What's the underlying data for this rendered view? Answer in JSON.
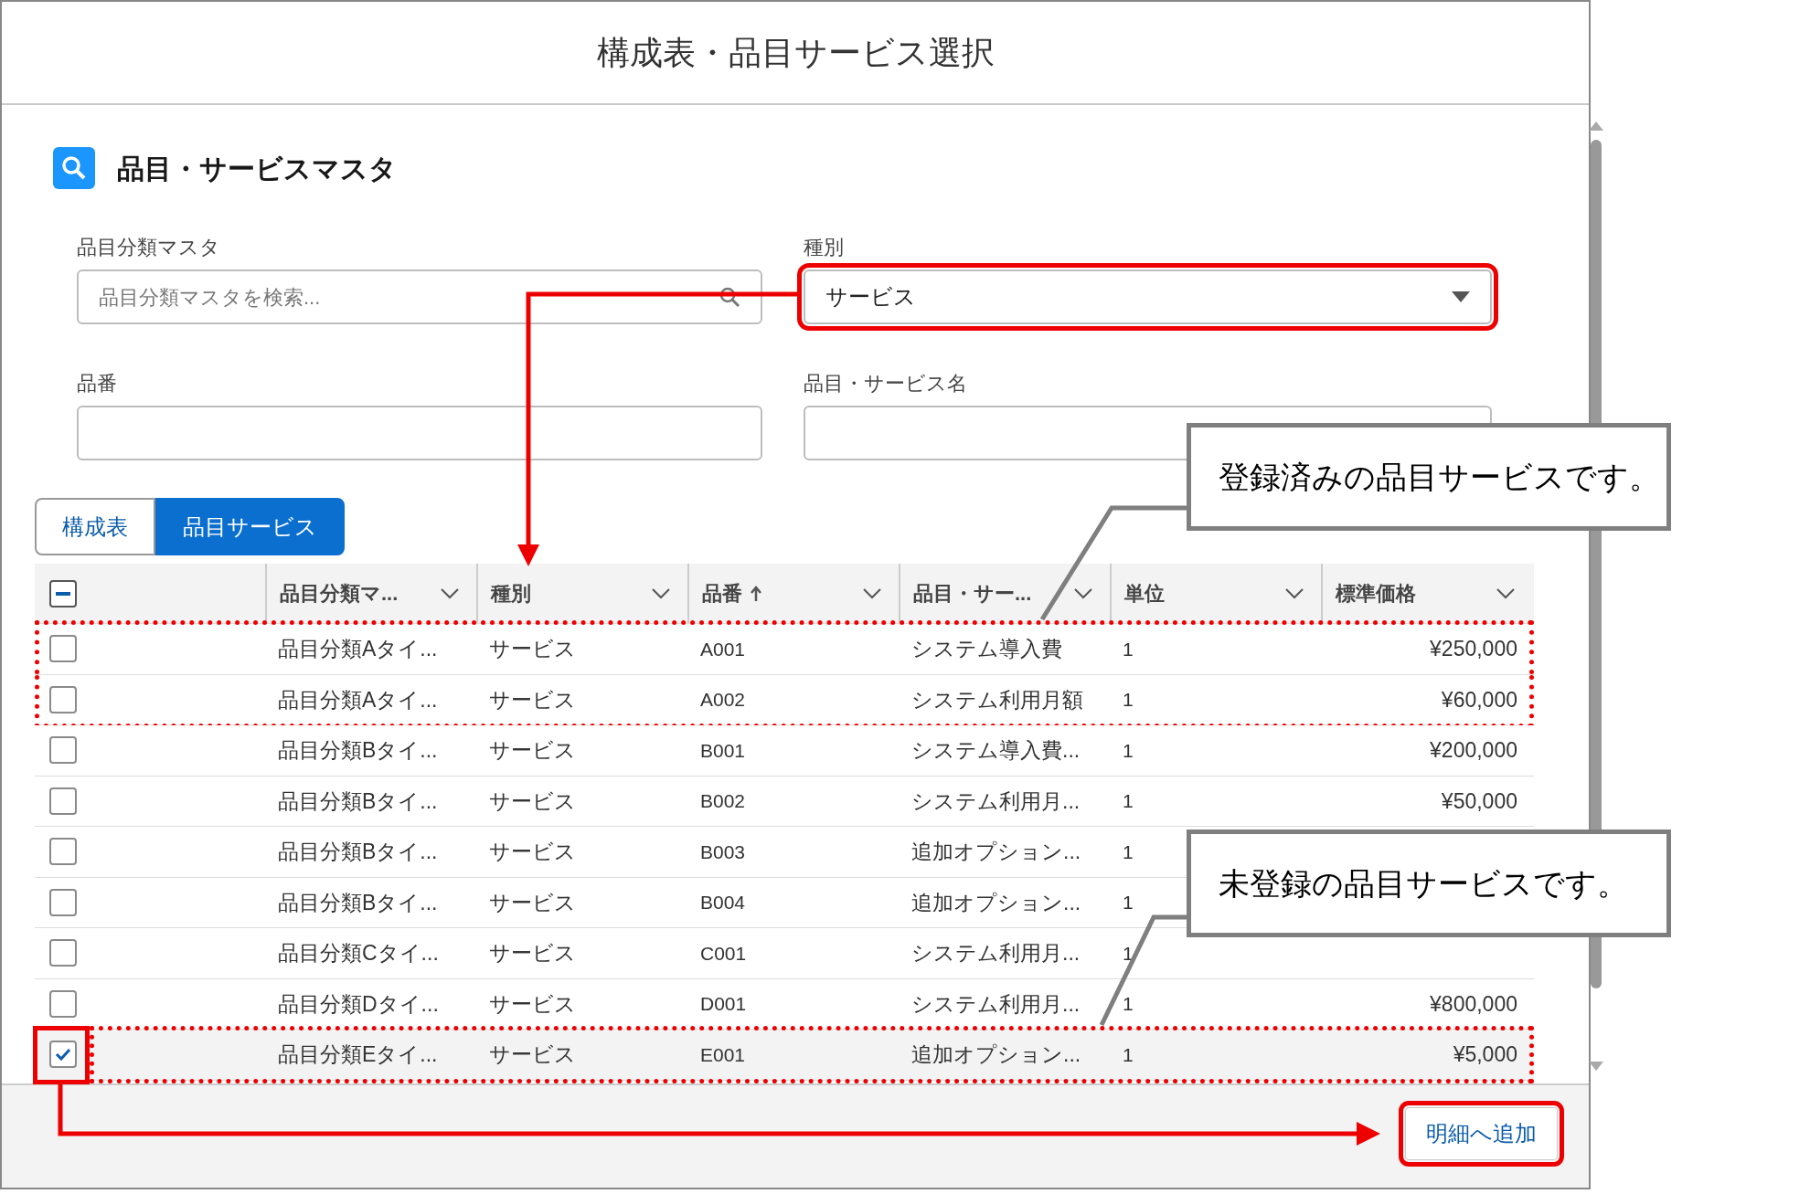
{
  "dialog": {
    "title": "構成表・品目サービス選択"
  },
  "section": {
    "title": "品目・サービスマスタ"
  },
  "filters": [
    {
      "label": "品目分類マスタ",
      "kind": "lookup",
      "placeholder": "品目分類マスタを検索...",
      "highlighted": false
    },
    {
      "label": "種別",
      "kind": "select",
      "value": "サービス",
      "highlighted": true
    },
    {
      "label": "品番",
      "kind": "text",
      "highlighted": false
    },
    {
      "label": "品目・サービス名",
      "kind": "text",
      "highlighted": false
    }
  ],
  "tabs": [
    {
      "label": "構成表",
      "selected": false
    },
    {
      "label": "品目サービス",
      "selected": true
    }
  ],
  "table": {
    "select_all": {
      "indeterminate": true
    },
    "columns": [
      {
        "label": "品目分類マ...",
        "sorted": false
      },
      {
        "label": "種別",
        "sorted": false
      },
      {
        "label": "品番",
        "sorted": true
      },
      {
        "label": "品目・サー...",
        "sorted": false
      },
      {
        "label": "単位",
        "sorted": false
      },
      {
        "label": "標準価格",
        "sorted": false
      }
    ],
    "rows": [
      {
        "checked": false,
        "marked": true,
        "cells": [
          "品目分類Aタイ...",
          "サービス",
          "A001",
          "システム導入費",
          "1",
          "¥250,000"
        ]
      },
      {
        "checked": false,
        "marked": true,
        "cells": [
          "品目分類Aタイ...",
          "サービス",
          "A002",
          "システム利用月額",
          "1",
          "¥60,000"
        ]
      },
      {
        "checked": false,
        "marked": false,
        "cells": [
          "品目分類Bタイ...",
          "サービス",
          "B001",
          "システム導入費...",
          "1",
          "¥200,000"
        ]
      },
      {
        "checked": false,
        "marked": false,
        "cells": [
          "品目分類Bタイ...",
          "サービス",
          "B002",
          "システム利用月...",
          "1",
          "¥50,000"
        ]
      },
      {
        "checked": false,
        "marked": false,
        "cells": [
          "品目分類Bタイ...",
          "サービス",
          "B003",
          "追加オプション...",
          "1"
        ]
      },
      {
        "checked": false,
        "marked": false,
        "cells": [
          "品目分類Bタイ...",
          "サービス",
          "B004",
          "追加オプション...",
          "1"
        ]
      },
      {
        "checked": false,
        "marked": false,
        "cells": [
          "品目分類Cタイ...",
          "サービス",
          "C001",
          "システム利用月...",
          "1"
        ]
      },
      {
        "checked": false,
        "marked": false,
        "cells": [
          "品目分類Dタイ...",
          "サービス",
          "D001",
          "システム利用月...",
          "1",
          "¥800,000"
        ]
      },
      {
        "checked": true,
        "marked": true,
        "cells": [
          "品目分類Eタイ...",
          "サービス",
          "E001",
          "追加オプション...",
          "1",
          "¥5,000"
        ]
      }
    ]
  },
  "footer": {
    "button": {
      "label": "明細へ追加",
      "highlighted": true
    }
  },
  "callouts": [
    {
      "text": "登録済みの品目サービスです。"
    },
    {
      "text": "未登録の品目サービスです。"
    }
  ]
}
